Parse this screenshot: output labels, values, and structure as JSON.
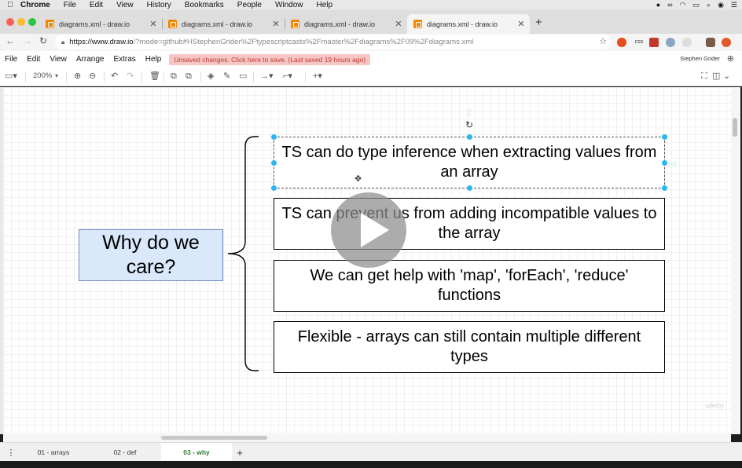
{
  "macos": {
    "apple": "",
    "menu": [
      "Chrome",
      "File",
      "Edit",
      "View",
      "History",
      "Bookmarks",
      "People",
      "Window",
      "Help"
    ]
  },
  "browser": {
    "tabs": [
      {
        "title": "diagrams.xml - draw.io",
        "active": false
      },
      {
        "title": "diagrams.xml - draw.io",
        "active": false
      },
      {
        "title": "diagrams.xml - draw.io",
        "active": false
      },
      {
        "title": "diagrams.xml - draw.io",
        "active": true
      }
    ],
    "url_host": "https://www.draw.io",
    "url_path": "/?mode=github#HStephenGrider%2Ftypescriptcasts%2Fmaster%2Fdiagrams%2F09%2Fdiagrams.xml",
    "ext_css": "css"
  },
  "drawio": {
    "menu": [
      "File",
      "Edit",
      "View",
      "Arrange",
      "Extras",
      "Help"
    ],
    "unsaved_notice": "Unsaved changes. Click here to save. (Last saved 19 hours ago)",
    "user": "Stephen Grider",
    "zoom": "200%",
    "pages": [
      {
        "label": "01 - arrays",
        "active": false
      },
      {
        "label": "02 - def",
        "active": false
      },
      {
        "label": "03 - why",
        "active": true
      }
    ]
  },
  "diagram": {
    "heading": "Why do we care?",
    "points": [
      "TS can do type inference when extracting values from an array",
      "TS can prevent us from adding incompatible values to the array",
      "We can get help with 'map', 'forEach', 'reduce' functions",
      "Flexible - arrays can still contain multiple different types"
    ]
  },
  "video": {
    "watermark": "udemy"
  },
  "colors": {
    "heading_fill": "#dae8fc",
    "heading_stroke": "#6c8ebf",
    "selection": "#29b6f2",
    "unsaved_bg": "#f5c6c6",
    "unsaved_text": "#c4362b"
  }
}
